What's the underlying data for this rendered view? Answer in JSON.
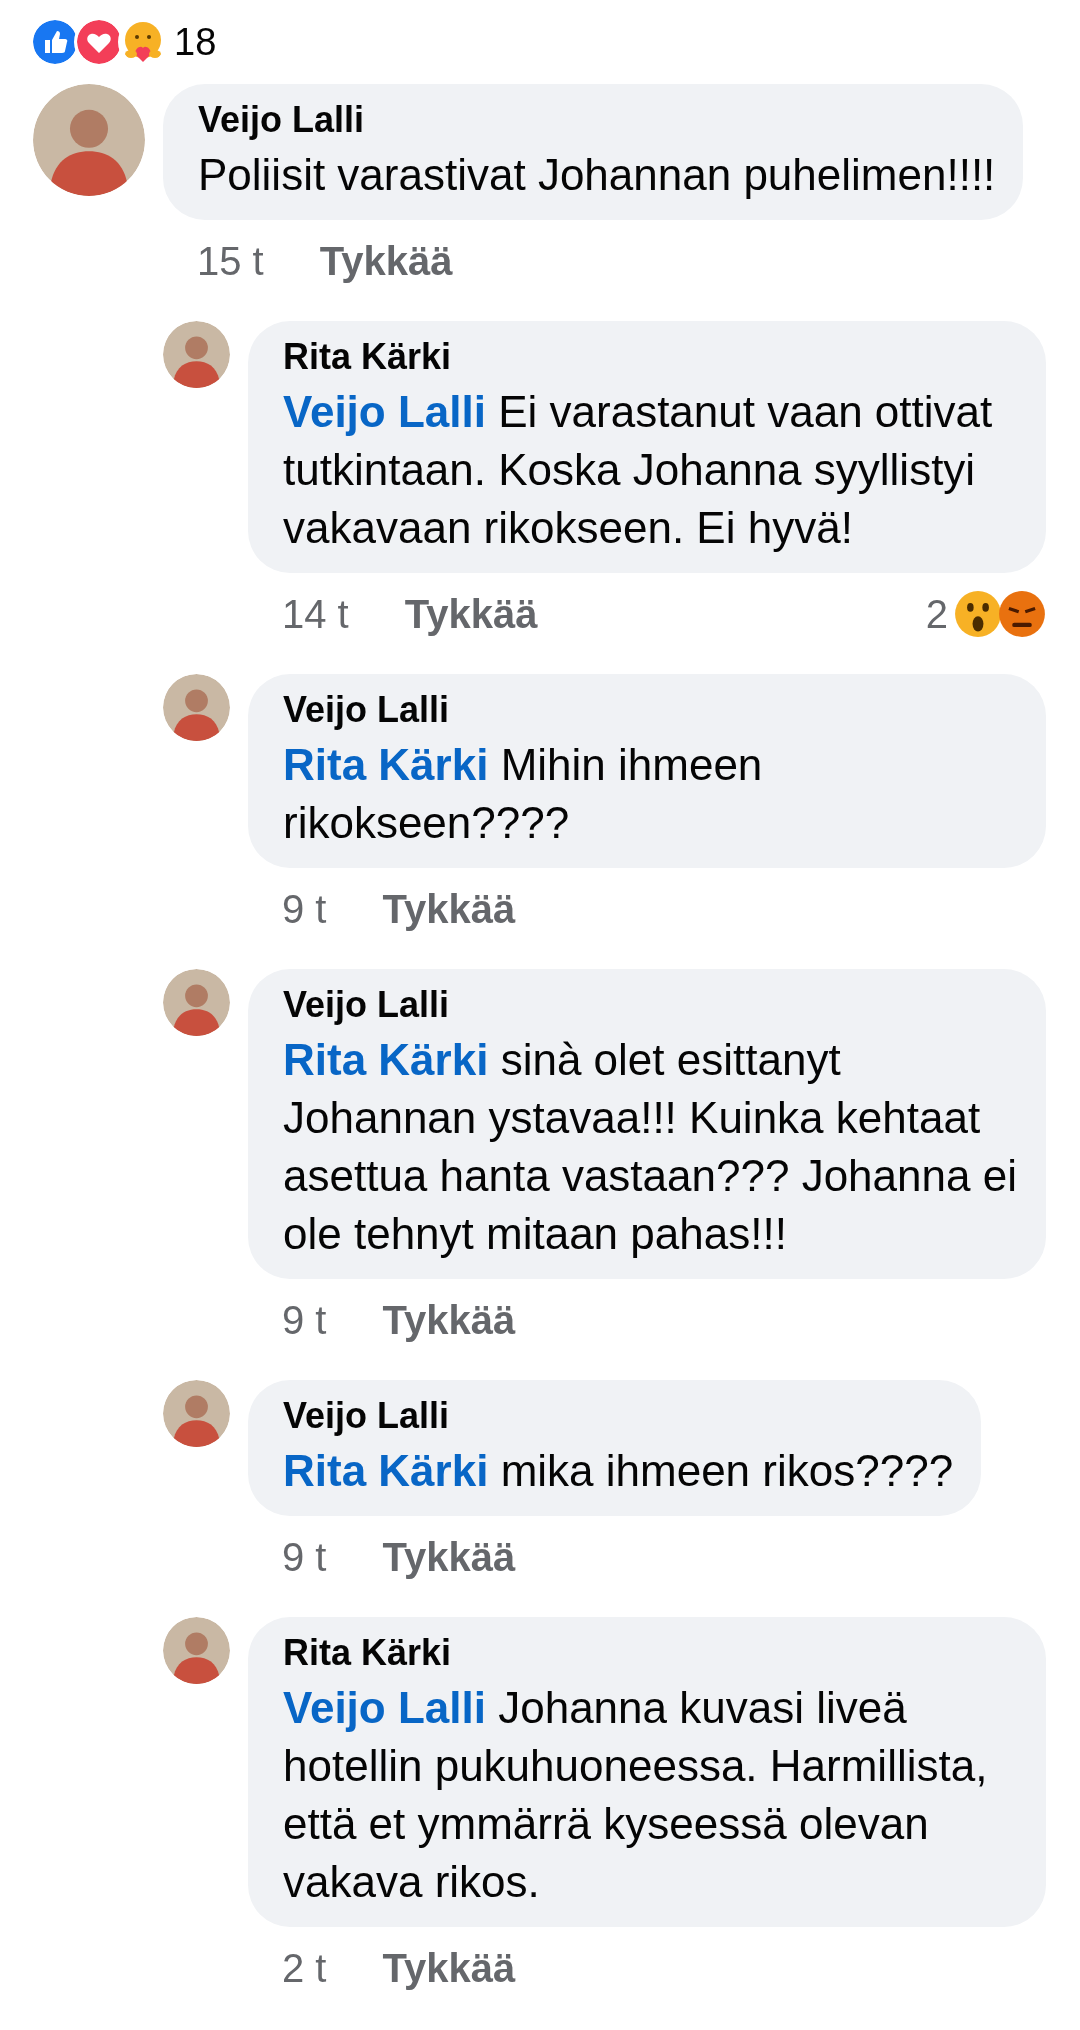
{
  "post_reactions": {
    "count": "18"
  },
  "comments": [
    {
      "author": "Veijo Lalli",
      "text": "Poliisit varastivat Johannan puhelimen!!!!",
      "time": "15 t",
      "like": "Tykkää",
      "nested": false
    },
    {
      "author": "Rita Kärki",
      "mention": "Veijo Lalli",
      "text": "Ei varastanut vaan ottivat tutkintaan. Koska Johanna syyllistyi vakavaan rikokseen. Ei hyvä!",
      "time": "14 t",
      "like": "Tykkää",
      "nested": true,
      "reactions": {
        "count": "2"
      }
    },
    {
      "author": "Veijo Lalli",
      "mention": "Rita Kärki",
      "text": "Mihin ihmeen rikokseen????",
      "time": "9 t",
      "like": "Tykkää",
      "nested": true
    },
    {
      "author": "Veijo Lalli",
      "mention": "Rita Kärki",
      "text": "sinà olet esittanyt Johannan ystavaa!!! Kuinka kehtaat asettua hanta vastaan??? Johanna ei ole tehnyt mitaan pahas!!!",
      "time": "9 t",
      "like": "Tykkää",
      "nested": true
    },
    {
      "author": "Veijo Lalli",
      "mention": "Rita Kärki",
      "text": "mika ihmeen rikos????",
      "time": "9 t",
      "like": "Tykkää",
      "nested": true
    },
    {
      "author": "Rita Kärki",
      "mention": "Veijo Lalli",
      "text": "Johanna kuvasi liveä hotellin pukuhuoneessa. Harmillista, että et ymmärrä kyseessä olevan vakava rikos.",
      "time": "2 t",
      "like": "Tykkää",
      "nested": true
    }
  ]
}
